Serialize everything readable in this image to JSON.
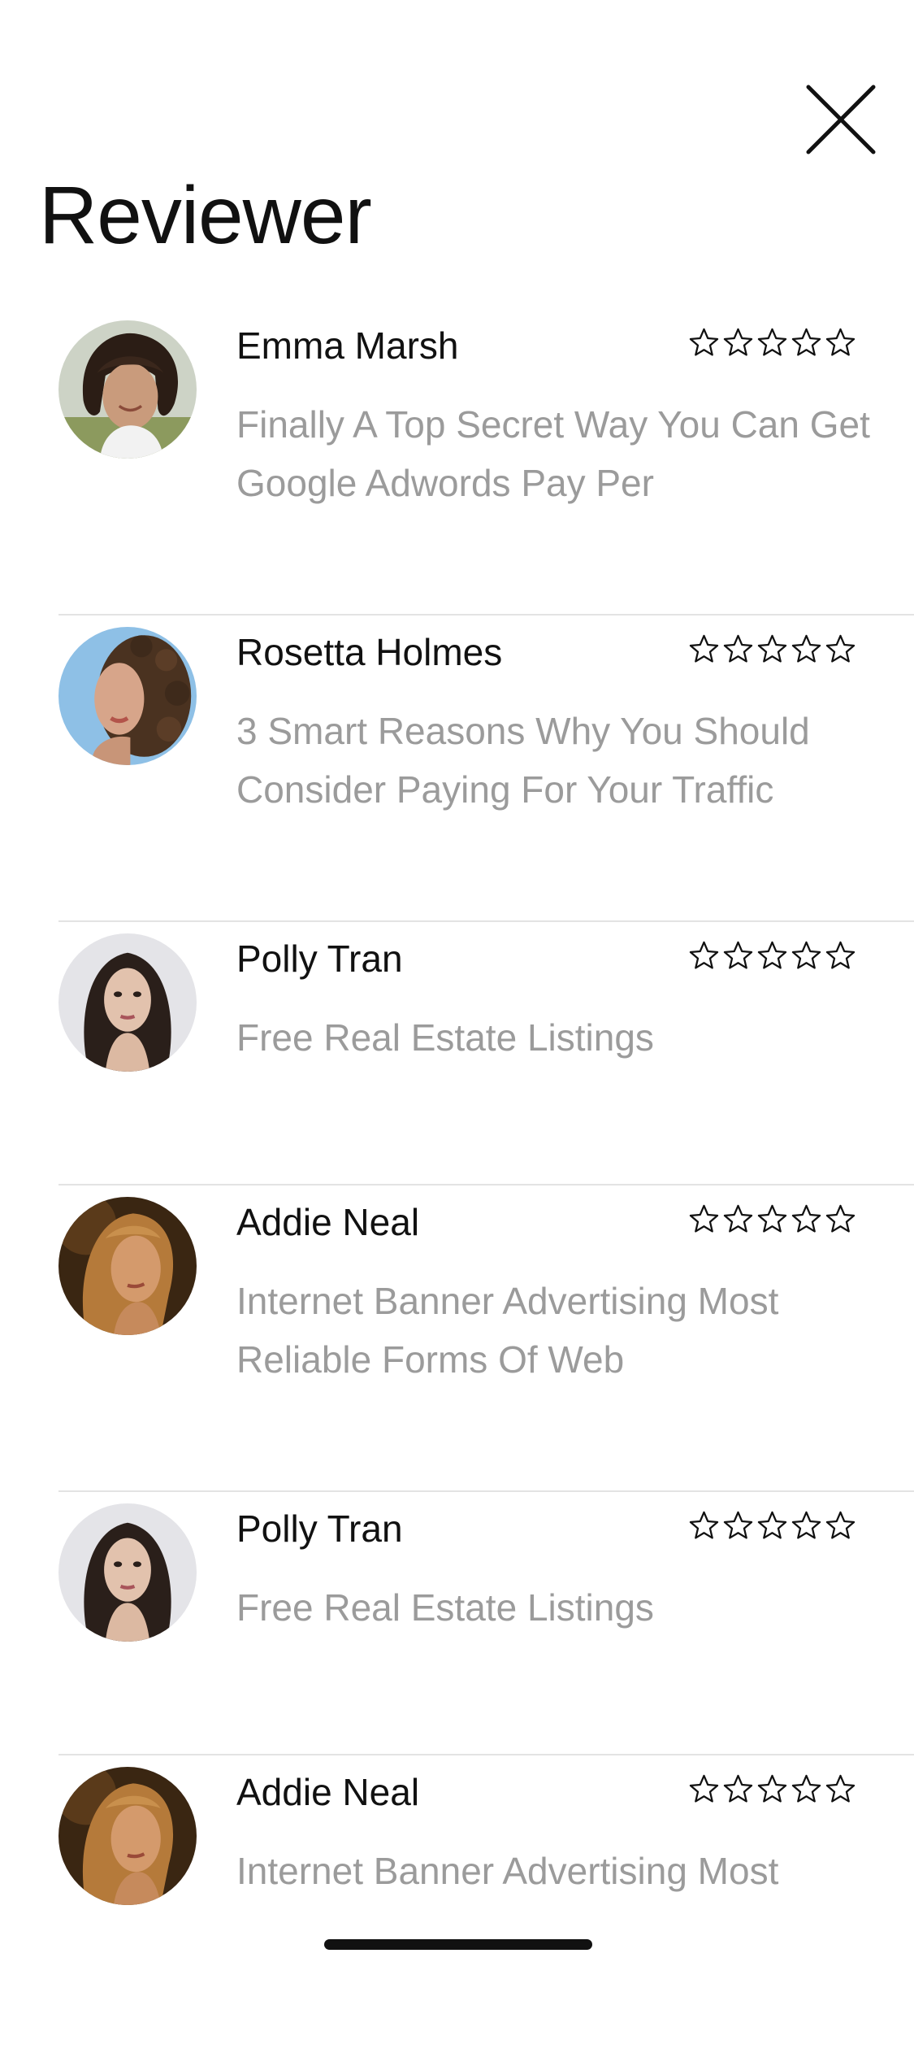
{
  "header": {
    "title": "Reviewer",
    "close_icon": "close-icon"
  },
  "reviews": [
    {
      "name": "Emma Marsh",
      "text": "Finally A Top Secret Way You Can Get Google Adwords Pay Per",
      "rating": 0,
      "max_rating": 5,
      "avatar_icon": "avatar-emma-marsh"
    },
    {
      "name": "Rosetta Holmes",
      "text": "3 Smart Reasons Why You Should Consider Paying For Your Traffic",
      "rating": 0,
      "max_rating": 5,
      "avatar_icon": "avatar-rosetta-holmes"
    },
    {
      "name": "Polly Tran",
      "text": "Free Real Estate Listings",
      "rating": 0,
      "max_rating": 5,
      "avatar_icon": "avatar-polly-tran"
    },
    {
      "name": "Addie Neal",
      "text": "Internet Banner Advertising Most Reliable Forms Of Web",
      "rating": 0,
      "max_rating": 5,
      "avatar_icon": "avatar-addie-neal"
    },
    {
      "name": "Polly Tran",
      "text": "Free Real Estate Listings",
      "rating": 0,
      "max_rating": 5,
      "avatar_icon": "avatar-polly-tran"
    },
    {
      "name": "Addie Neal",
      "text": "Internet Banner Advertising Most",
      "rating": 0,
      "max_rating": 5,
      "avatar_icon": "avatar-addie-neal"
    }
  ],
  "colors": {
    "text_primary": "#111111",
    "text_secondary": "#9b9b9b",
    "divider": "#e3e3e3",
    "background": "#ffffff"
  }
}
